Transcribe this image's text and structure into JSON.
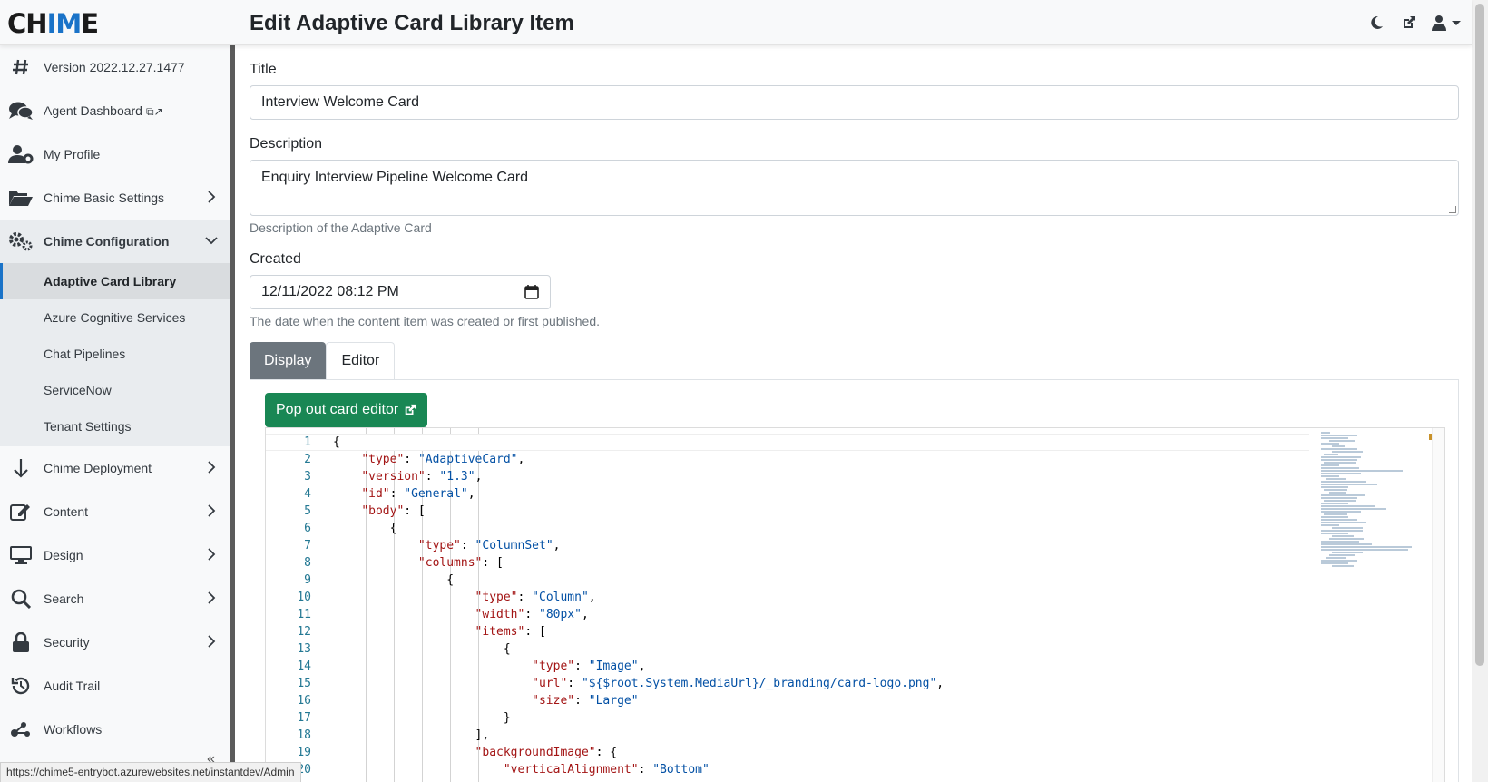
{
  "app": {
    "logo_part1": "CH",
    "logo_part2": "IM",
    "logo_part3": "E",
    "page_title": "Edit Adaptive Card Library Item",
    "accent_color": "#1a73c8"
  },
  "header_icons": [
    "moon-icon",
    "external-link-icon",
    "user-icon",
    "caret-down-icon"
  ],
  "sidebar": {
    "items": [
      {
        "label": "Version 2022.12.27.1477",
        "icon": "hash-icon"
      },
      {
        "label": "Agent Dashboard",
        "icon": "comments-icon",
        "ext": "⧉↗"
      },
      {
        "label": "My Profile",
        "icon": "user-gear-icon"
      },
      {
        "label": "Chime Basic Settings",
        "icon": "folder-open-icon"
      },
      {
        "label": "Chime Configuration",
        "icon": "gears-icon"
      },
      {
        "label": "Chime Deployment",
        "icon": "arrow-down-icon"
      },
      {
        "label": "Content",
        "icon": "edit-icon"
      },
      {
        "label": "Design",
        "icon": "monitor-icon"
      },
      {
        "label": "Search",
        "icon": "search-icon"
      },
      {
        "label": "Security",
        "icon": "lock-icon"
      },
      {
        "label": "Audit Trail",
        "icon": "history-icon"
      },
      {
        "label": "Workflows",
        "icon": "workflow-icon"
      }
    ],
    "config_subitems": [
      "Adaptive Card Library",
      "Azure Cognitive Services",
      "Chat Pipelines",
      "ServiceNow",
      "Tenant Settings"
    ]
  },
  "form": {
    "title_label": "Title",
    "title_value": "Interview Welcome Card",
    "description_label": "Description",
    "description_value": "Enquiry Interview Pipeline Welcome Card",
    "description_help": "Description of the Adaptive Card",
    "created_label": "Created",
    "created_value": "12/11/2022 08:12 PM",
    "created_help": "The date when the content item was created or first published."
  },
  "tabs": {
    "display": "Display",
    "editor": "Editor"
  },
  "editor": {
    "popout_label": "Pop out card editor",
    "lines": [
      {
        "n": "1",
        "text": "{"
      },
      {
        "n": "2",
        "text": "    \"type\": \"AdaptiveCard\","
      },
      {
        "n": "3",
        "text": "    \"version\": \"1.3\","
      },
      {
        "n": "4",
        "text": "    \"id\": \"General\","
      },
      {
        "n": "5",
        "text": "    \"body\": ["
      },
      {
        "n": "6",
        "text": "        {"
      },
      {
        "n": "7",
        "text": "            \"type\": \"ColumnSet\","
      },
      {
        "n": "8",
        "text": "            \"columns\": ["
      },
      {
        "n": "9",
        "text": "                {"
      },
      {
        "n": "10",
        "text": "                    \"type\": \"Column\","
      },
      {
        "n": "11",
        "text": "                    \"width\": \"80px\","
      },
      {
        "n": "12",
        "text": "                    \"items\": ["
      },
      {
        "n": "13",
        "text": "                        {"
      },
      {
        "n": "14",
        "text": "                            \"type\": \"Image\","
      },
      {
        "n": "15",
        "text": "                            \"url\": \"${$root.System.MediaUrl}/_branding/card-logo.png\","
      },
      {
        "n": "16",
        "text": "                            \"size\": \"Large\""
      },
      {
        "n": "17",
        "text": "                        }"
      },
      {
        "n": "18",
        "text": "                    ],"
      },
      {
        "n": "19",
        "text": "                    \"backgroundImage\": {"
      },
      {
        "n": "20",
        "text": "                        \"verticalAlignment\": \"Bottom\""
      }
    ]
  },
  "status_url": "https://chime5-entrybot.azurewebsites.net/instantdev/Admin"
}
